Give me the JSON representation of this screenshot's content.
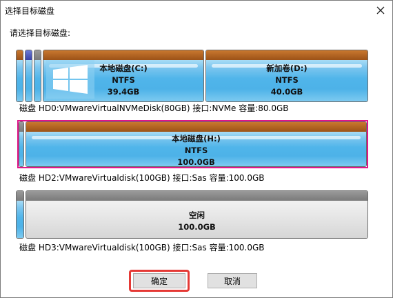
{
  "window": {
    "title": "选择目标磁盘"
  },
  "prompt": "请选择目标磁盘:",
  "disks": [
    {
      "info": "磁盘 HD0:VMwareVirtualNVMeDisk(80GB)  接口:NVMe  容量:80.0GB",
      "partitions": [
        {
          "name": "本地磁盘(C:)",
          "fs": "NTFS",
          "size": "39.4GB"
        },
        {
          "name": "新加卷(D:)",
          "fs": "NTFS",
          "size": "40.0GB"
        }
      ]
    },
    {
      "info": "磁盘 HD2:VMwareVirtualdisk(100GB)  接口:Sas  容量:100.0GB",
      "partitions": [
        {
          "name": "本地磁盘(H:)",
          "fs": "NTFS",
          "size": "100.0GB"
        }
      ]
    },
    {
      "info": "磁盘 HD3:VMwareVirtualdisk(100GB)  接口:Sas  容量:100.0GB",
      "partitions": [
        {
          "name": "空闲",
          "size": "100.0GB"
        }
      ]
    }
  ],
  "buttons": {
    "ok": "确定",
    "cancel": "取消"
  },
  "icons": {
    "close": "close-icon",
    "windows": "windows-logo-icon"
  },
  "colors": {
    "selection": "#e0158a",
    "focus_highlight": "#e53935",
    "partition_fill": "#4db2e8"
  }
}
